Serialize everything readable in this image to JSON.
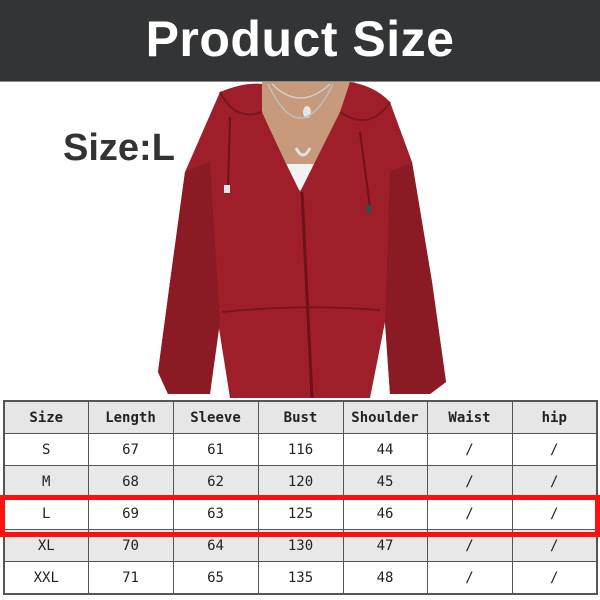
{
  "header": {
    "title": "Product Size"
  },
  "product": {
    "image": "red-hooded-zip-jacket-photo",
    "jacket_color": "#9e1f2a",
    "size_label": "Size:L"
  },
  "table": {
    "columns": [
      "Size",
      "Length",
      "Sleeve",
      "Bust",
      "Shoulder",
      "Waist",
      "hip"
    ],
    "rows": [
      [
        "S",
        "67",
        "61",
        "116",
        "44",
        "/",
        "/"
      ],
      [
        "M",
        "68",
        "62",
        "120",
        "45",
        "/",
        "/"
      ],
      [
        "L",
        "69",
        "63",
        "125",
        "46",
        "/",
        "/"
      ],
      [
        "XL",
        "70",
        "64",
        "130",
        "47",
        "/",
        "/"
      ],
      [
        "XXL",
        "71",
        "65",
        "135",
        "48",
        "/",
        "/"
      ]
    ],
    "highlighted_size": "L",
    "highlight_color": "#ff1010"
  }
}
